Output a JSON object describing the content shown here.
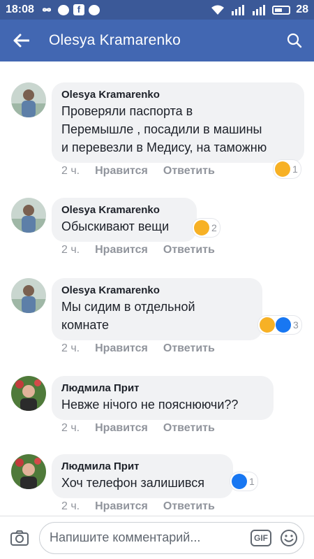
{
  "status_bar": {
    "time": "18:08",
    "battery": "28",
    "network": "4G"
  },
  "header": {
    "title": "Olesya Kramarenko"
  },
  "colors": {
    "brand": "#4267b2",
    "status": "#3b5998",
    "bubble": "#f1f2f4",
    "meta": "#90949c",
    "like": "#1877f2",
    "wow": "#f7b125"
  },
  "comments": [
    {
      "author": "Olesya Kramarenko",
      "text": "Проверяли паспорта в\nПеремышле , посадили в машины\nи перевезли в Медису, на таможню",
      "time": "2 ч.",
      "like_label": "Нравится",
      "reply_label": "Ответить",
      "reactions": [
        "wow-icon"
      ],
      "reaction_count": "1"
    },
    {
      "author": "Olesya Kramarenko",
      "text": "Обыскивают вещи",
      "time": "2 ч.",
      "like_label": "Нравится",
      "reply_label": "Ответить",
      "reactions": [
        "wow-icon"
      ],
      "reaction_count": "2"
    },
    {
      "author": "Olesya Kramarenko",
      "text": "Мы сидим в отдельной\nкомнате",
      "time": "2 ч.",
      "like_label": "Нравится",
      "reply_label": "Ответить",
      "reactions": [
        "wow-icon",
        "like-icon"
      ],
      "reaction_count": "3"
    },
    {
      "author": "Людмила Прит",
      "text": "Невже нічого не пояснюючи??",
      "time": "2 ч.",
      "like_label": "Нравится",
      "reply_label": "Ответить",
      "reactions": [],
      "reaction_count": ""
    },
    {
      "author": "Людмила Прит",
      "text": "Хоч телефон залишився",
      "time": "2 ч.",
      "like_label": "Нравится",
      "reply_label": "Ответить",
      "reactions": [
        "like-icon"
      ],
      "reaction_count": "1"
    }
  ],
  "composer": {
    "placeholder": "Напишите комментарий...",
    "gif_label": "GIF"
  }
}
